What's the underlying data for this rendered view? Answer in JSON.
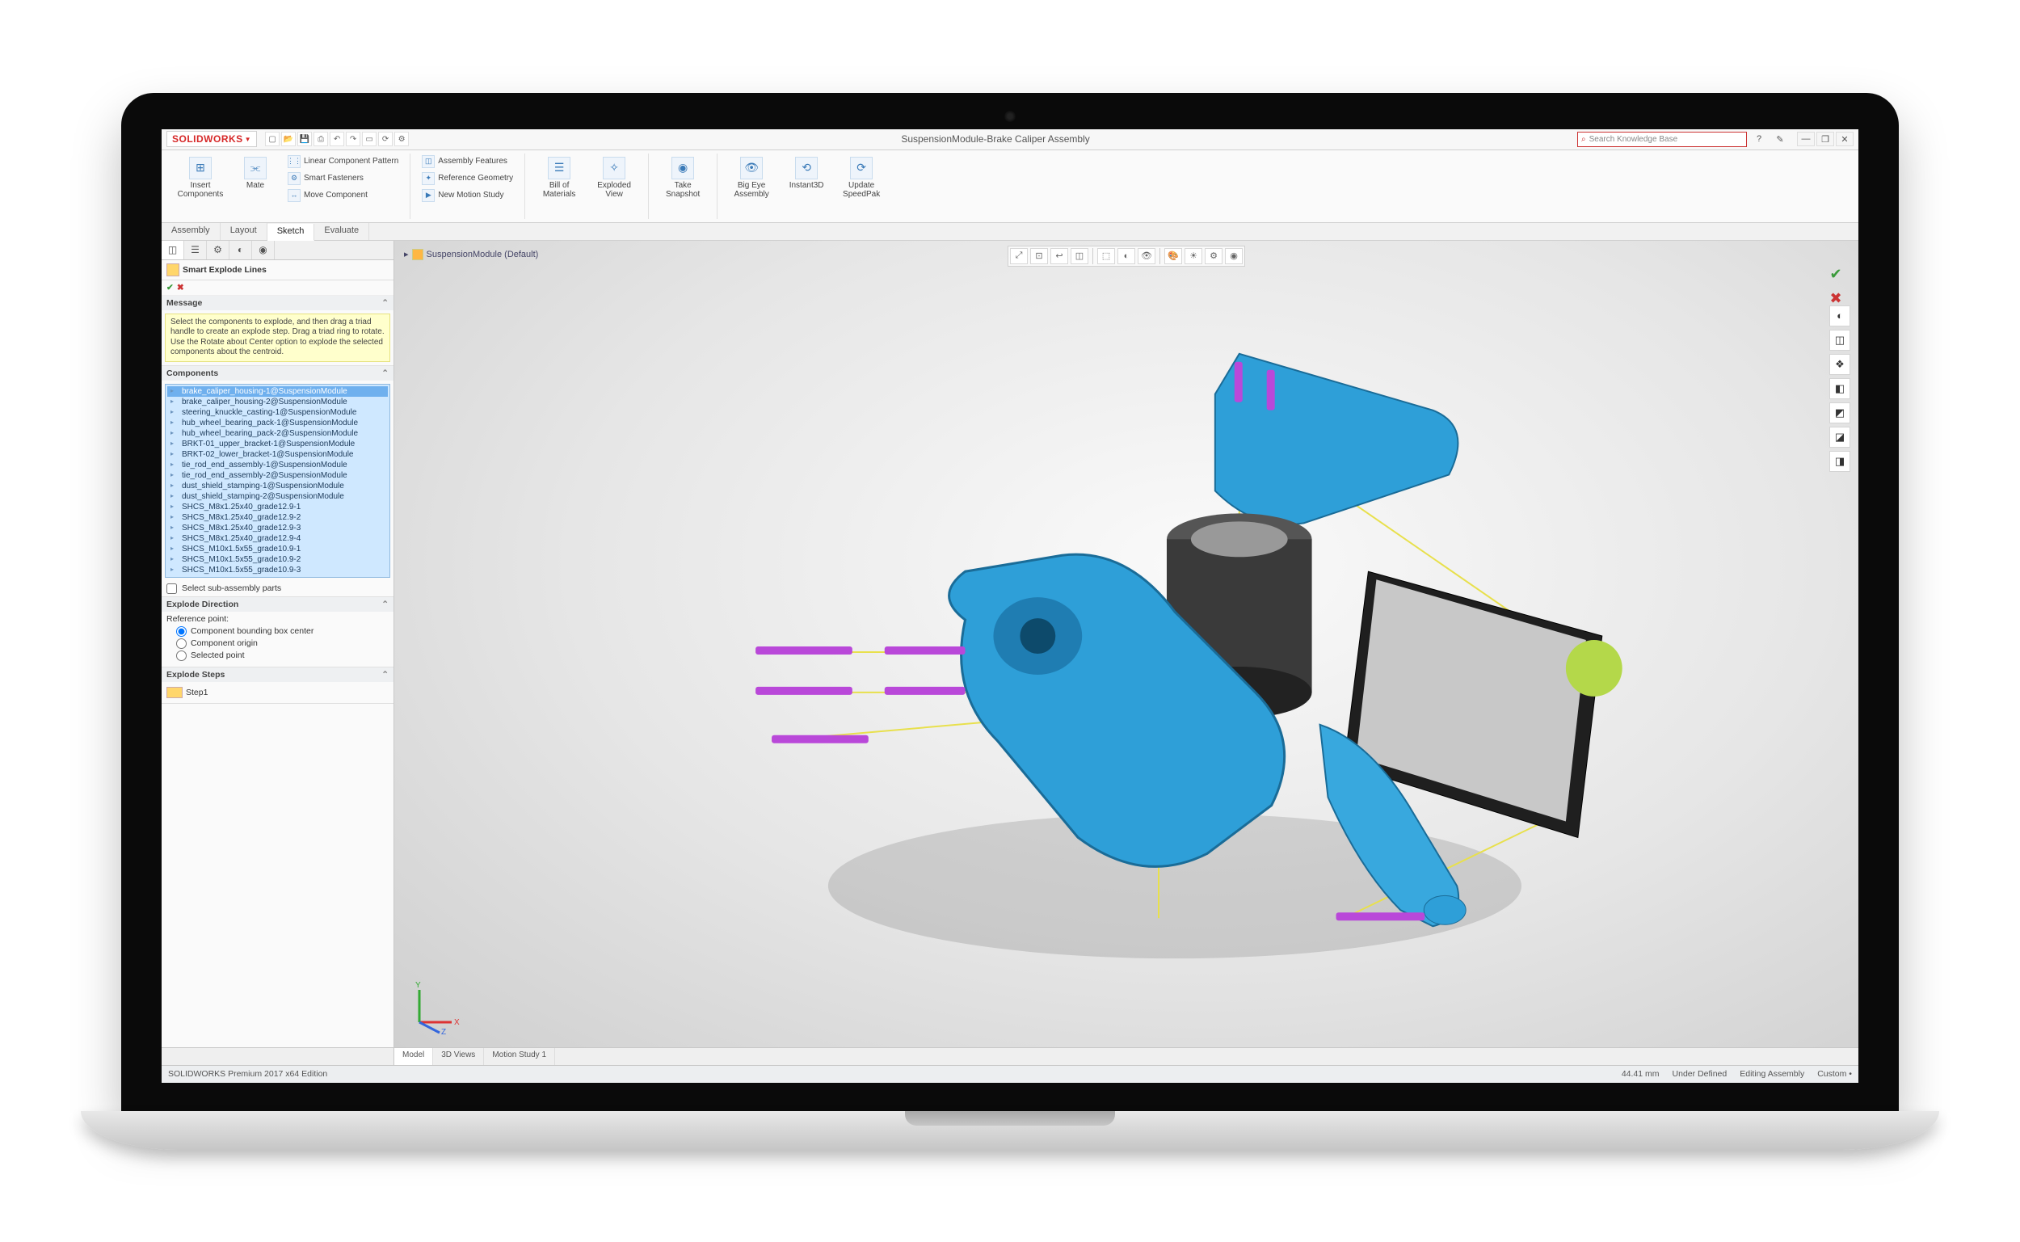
{
  "app": {
    "name": "SOLIDWORKS",
    "windowTitle": "SuspensionModule-Brake Caliper Assembly",
    "search": {
      "placeholder": "Search Knowledge Base"
    }
  },
  "qat": [
    "new",
    "open",
    "save",
    "print",
    "undo",
    "redo",
    "select",
    "rebuild",
    "options"
  ],
  "winControls": {
    "help": "?",
    "options": "✎",
    "min": "—",
    "max": "❐",
    "close": "✕"
  },
  "ribbon": {
    "groups": [
      {
        "name": "assembly",
        "big": [
          {
            "label": "Insert Components",
            "icon": "⊞"
          },
          {
            "label": "Mate",
            "icon": "⫘"
          }
        ],
        "stack": [
          {
            "label": "Linear Component Pattern",
            "icon": "⋮⋮"
          },
          {
            "label": "Smart Fasteners",
            "icon": "⚙"
          },
          {
            "label": "Move Component",
            "icon": "↔"
          }
        ]
      },
      {
        "name": "features",
        "stack": [
          {
            "label": "Assembly Features",
            "icon": "◫"
          },
          {
            "label": "Reference Geometry",
            "icon": "✦"
          },
          {
            "label": "New Motion Study",
            "icon": "▶"
          }
        ]
      },
      {
        "name": "evaluate",
        "big": [
          {
            "label": "Bill of Materials",
            "icon": "☰"
          },
          {
            "label": "Exploded View",
            "icon": "✧"
          }
        ]
      },
      {
        "name": "render",
        "big": [
          {
            "label": "Take Snapshot",
            "icon": "◉"
          }
        ]
      },
      {
        "name": "tools",
        "big": [
          {
            "label": "Big Eye Assembly",
            "icon": "👁"
          },
          {
            "label": "Instant3D",
            "icon": "⟲"
          },
          {
            "label": "Update SpeedPak",
            "icon": "⟳"
          }
        ]
      }
    ]
  },
  "commandTabs": [
    "Assembly",
    "Layout",
    "Sketch",
    "Evaluate"
  ],
  "commandTabActive": 2,
  "panel": {
    "tabs": [
      "feature",
      "property",
      "config",
      "display",
      "appearance"
    ],
    "activeTab": 0,
    "title": "Smart Explode Lines",
    "message": "Select the components to explode, and then drag a triad handle to create an explode step. Drag a triad ring to rotate. Use the Rotate about Center option to explode the selected components about the centroid.",
    "sections": {
      "components": {
        "title": "Components",
        "items": [
          "brake_caliper_housing-1@SuspensionModule",
          "brake_caliper_housing-2@SuspensionModule",
          "steering_knuckle_casting-1@SuspensionModule",
          "hub_wheel_bearing_pack-1@SuspensionModule",
          "hub_wheel_bearing_pack-2@SuspensionModule",
          "BRKT-01_upper_bracket-1@SuspensionModule",
          "BRKT-02_lower_bracket-1@SuspensionModule",
          "tie_rod_end_assembly-1@SuspensionModule",
          "tie_rod_end_assembly-2@SuspensionModule",
          "dust_shield_stamping-1@SuspensionModule",
          "dust_shield_stamping-2@SuspensionModule",
          "SHCS_M8x1.25x40_grade12.9-1",
          "SHCS_M8x1.25x40_grade12.9-2",
          "SHCS_M8x1.25x40_grade12.9-3",
          "SHCS_M8x1.25x40_grade12.9-4",
          "SHCS_M10x1.5x55_grade10.9-1",
          "SHCS_M10x1.5x55_grade10.9-2",
          "SHCS_M10x1.5x55_grade10.9-3"
        ],
        "selectedIndex": 0,
        "checkbox": "Select sub-assembly parts"
      },
      "explodeDir": {
        "title": "Explode Direction",
        "refPoint": "Reference point:",
        "options": [
          "Component bounding box center",
          "Component origin",
          "Selected point"
        ],
        "selected": 0
      },
      "steps": {
        "title": "Explode Steps",
        "item": "Step1"
      }
    }
  },
  "bottomTabs": [
    "Model",
    "3D Views",
    "Motion Study 1"
  ],
  "bottomActive": 0,
  "viewportToolbar": [
    "zoom-fit",
    "zoom-area",
    "prev-view",
    "section",
    "view-orient",
    "display-style",
    "hide-show",
    "edit-appearance",
    "scene",
    "view-settings",
    "render"
  ],
  "viewCrumb": "SuspensionModule (Default)",
  "taskIcons": [
    "◐",
    "◫",
    "❖",
    "◧",
    "◩",
    "◪",
    "◨"
  ],
  "status": {
    "left": "SOLIDWORKS Premium 2017 x64 Edition",
    "right": [
      "44.41 mm",
      "Under Defined",
      "Editing Assembly",
      "Custom •"
    ]
  },
  "triad": {
    "x": "X",
    "y": "Y",
    "z": "Z"
  }
}
